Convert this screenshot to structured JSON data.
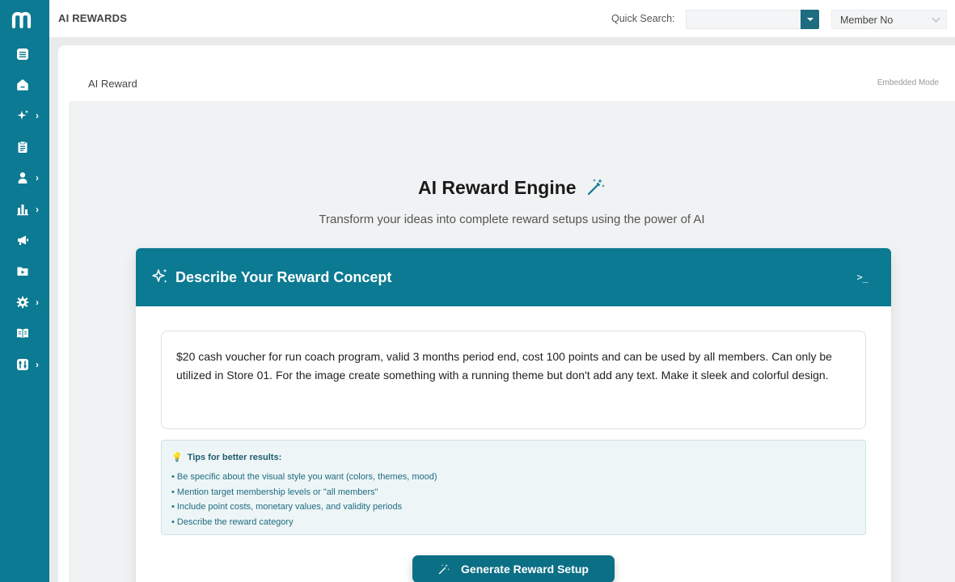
{
  "topbar": {
    "app_title": "AI REWARDS",
    "quick_search_label": "Quick Search:",
    "quick_search_value": "",
    "member_select_value": "Member No"
  },
  "sidebar": {
    "items": [
      {
        "icon": "list-icon",
        "has_submenu": false
      },
      {
        "icon": "home-icon",
        "has_submenu": false
      },
      {
        "icon": "sparkle-icon",
        "has_submenu": true
      },
      {
        "icon": "clipboard-icon",
        "has_submenu": false
      },
      {
        "icon": "user-icon",
        "has_submenu": true
      },
      {
        "icon": "bar-chart-icon",
        "has_submenu": true
      },
      {
        "icon": "megaphone-icon",
        "has_submenu": false
      },
      {
        "icon": "folder-play-icon",
        "has_submenu": false
      },
      {
        "icon": "gear-icon",
        "has_submenu": true
      },
      {
        "icon": "book-open-icon",
        "has_submenu": false
      },
      {
        "icon": "tools-icon",
        "has_submenu": true
      }
    ],
    "submenu_chevron": "›"
  },
  "page": {
    "breadcrumb": "AI Reward",
    "mode_label": "Embedded Mode",
    "heading": "AI Reward Engine",
    "subheading": "Transform your ideas into complete reward setups using the power of AI"
  },
  "concept": {
    "title": "Describe Your Reward Concept",
    "terminal_glyph": ">_",
    "input_text": "$20 cash voucher for run coach program, valid 3 months period end, cost 100 points and can be used by all members. Can only be utilized in Store 01. For the image create something with a running theme but don't add any text. Make it sleek and colorful design.",
    "tips_icon": "💡",
    "tips_title": "Tips for better results:",
    "tips": [
      "• Be specific about the visual style you want (colors, themes, mood)",
      "• Mention target membership levels or \"all members\"",
      "• Include point costs, monetary values, and validity periods",
      "• Describe the reward category"
    ],
    "generate_label": "Generate Reward Setup"
  },
  "colors": {
    "brand": "#0b7a92",
    "button": "#0b6f85",
    "tip_text": "#1d6c80"
  }
}
